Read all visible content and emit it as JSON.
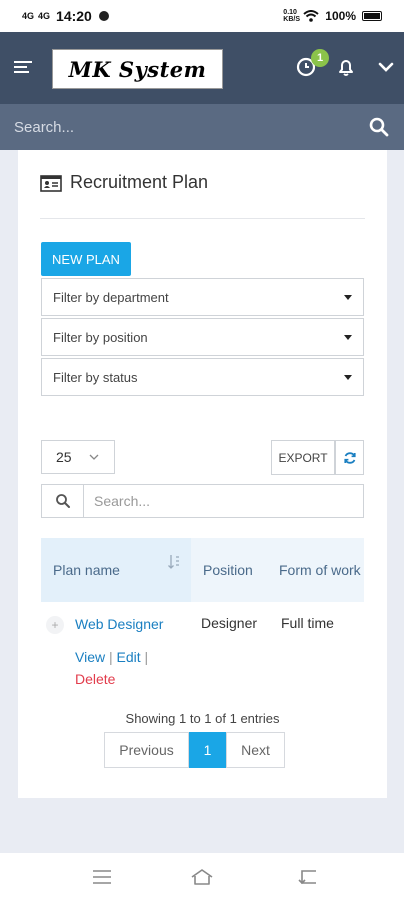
{
  "status_bar": {
    "signal_1": "4G",
    "signal_2": "4G",
    "time": "14:20",
    "speed_top": "0.10",
    "speed_bottom": "KB/S",
    "battery": "100%"
  },
  "header": {
    "logo_text": "MK System",
    "notification_count": "1"
  },
  "search": {
    "placeholder": "Search..."
  },
  "page": {
    "title": "Recruitment Plan",
    "new_plan_label": "NEW PLAN",
    "filters": {
      "department": "Filter by department",
      "position": "Filter by position",
      "status": "Filter by status"
    }
  },
  "table_controls": {
    "page_size": "25",
    "export_label": "EXPORT",
    "search_placeholder": "Search..."
  },
  "table": {
    "columns": [
      "Plan name",
      "Position",
      "Form of work"
    ],
    "rows": [
      {
        "expander": "+",
        "plan_name": "Web Designer",
        "position": "Designer",
        "form_of_work": "Full time",
        "actions": {
          "view": "View",
          "edit": "Edit",
          "delete": "Delete",
          "sep": "|"
        }
      }
    ]
  },
  "pagination": {
    "info": "Showing 1 to 1 of 1 entries",
    "previous": "Previous",
    "current": "1",
    "next": "Next"
  },
  "colors": {
    "header_bg": "#3f4f66",
    "search_bg": "#5a6a82",
    "accent": "#1aa6e6",
    "link": "#1a7fc1",
    "danger": "#e23c4c",
    "badge": "#8bc34a"
  }
}
